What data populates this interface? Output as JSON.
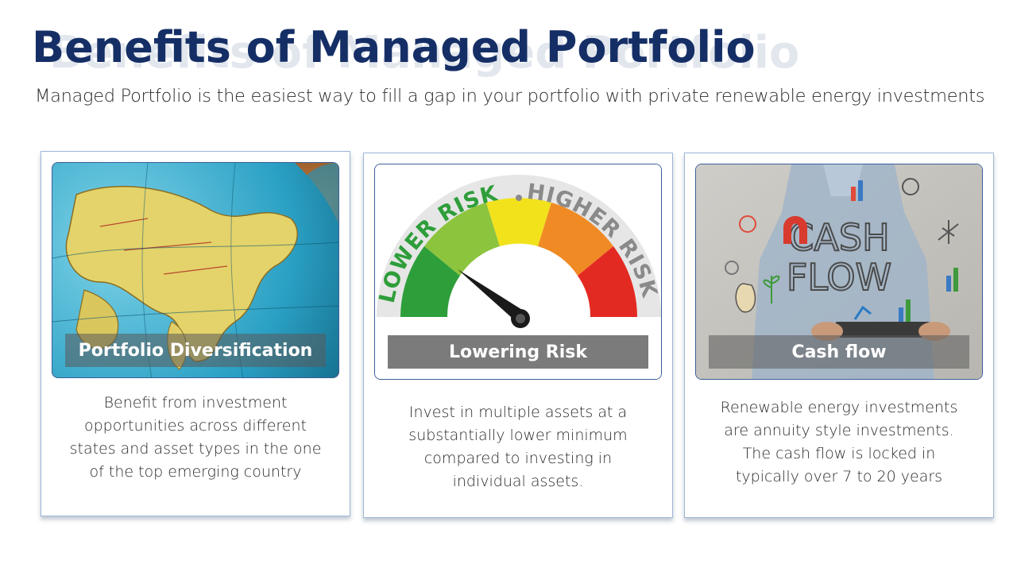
{
  "header": {
    "title": "Benefits of Managed Portfolio",
    "subtitle": "Managed Portfolio is the easiest way to fill a gap in your portfolio with private renewable energy investments"
  },
  "cards": [
    {
      "label": "Portfolio Diversification",
      "image": "globe-image",
      "description": "Benefit from investment opportunities across different states and asset types in the one of the top emerging country"
    },
    {
      "label": "Lowering Risk",
      "image": "risk-gauge-image",
      "gauge_text_left": "LOWER RISK",
      "gauge_text_right": "HIGHER RISK",
      "description": "Invest in multiple assets at a substantially lower minimum compared to investing in individual assets."
    },
    {
      "label": "Cash flow",
      "image": "cash-flow-image",
      "image_text_line1": "CASH",
      "image_text_line2": "FLOW",
      "description": "Renewable energy investments are annuity style investments. The cash flow is locked in typically over 7 to 20 years"
    }
  ],
  "colors": {
    "title": "#152f66",
    "card_border": "#9db6d8",
    "gauge": [
      "#2e9e3a",
      "#8cc43e",
      "#f2e21c",
      "#f08a24",
      "#e32a22"
    ]
  }
}
